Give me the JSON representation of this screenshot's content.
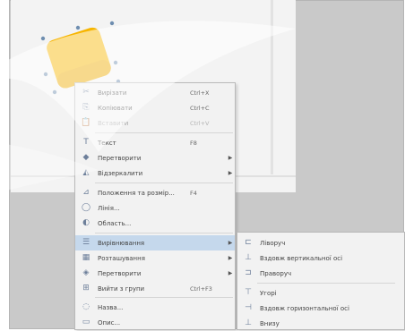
{
  "context_menu": {
    "items": [
      {
        "label": "Вирізати",
        "shortcut": "Ctrl+X",
        "icon": "scissors-icon",
        "glyph": "✂",
        "disabled": false,
        "submenu": false
      },
      {
        "label": "Копіювати",
        "shortcut": "Ctrl+C",
        "icon": "copy-icon",
        "glyph": "⎘",
        "disabled": false,
        "submenu": false
      },
      {
        "label": "Вставити",
        "shortcut": "Ctrl+V",
        "icon": "paste-icon",
        "glyph": "📋",
        "disabled": true,
        "submenu": false
      },
      {
        "label": "Текст",
        "shortcut": "F8",
        "icon": "text-icon",
        "glyph": "T",
        "disabled": false,
        "submenu": false
      },
      {
        "label": "Перетворити",
        "shortcut": "",
        "icon": "convert-icon",
        "glyph": "◆",
        "disabled": false,
        "submenu": true
      },
      {
        "label": "Відзеркалити",
        "shortcut": "",
        "icon": "mirror-icon",
        "glyph": "◭",
        "disabled": false,
        "submenu": true
      },
      {
        "label": "Положення та розмір...",
        "shortcut": "F4",
        "icon": "position-size-icon",
        "glyph": "⊿",
        "disabled": false,
        "submenu": false
      },
      {
        "label": "Лінія...",
        "shortcut": "",
        "icon": "line-icon",
        "glyph": "◯",
        "disabled": false,
        "submenu": false
      },
      {
        "label": "Область...",
        "shortcut": "",
        "icon": "area-icon",
        "glyph": "◐",
        "disabled": false,
        "submenu": false
      },
      {
        "label": "Вирівнювання",
        "shortcut": "",
        "icon": "align-icon",
        "glyph": "☰",
        "disabled": false,
        "submenu": true,
        "highlighted": true
      },
      {
        "label": "Розташування",
        "shortcut": "",
        "icon": "arrange-icon",
        "glyph": "▦",
        "disabled": false,
        "submenu": true
      },
      {
        "label": "Перетворити",
        "shortcut": "",
        "icon": "flip-icon",
        "glyph": "◈",
        "disabled": false,
        "submenu": true
      },
      {
        "label": "Вийти з групи",
        "shortcut": "Ctrl+F3",
        "icon": "exit-group-icon",
        "glyph": "⊞",
        "disabled": false,
        "submenu": false
      },
      {
        "label": "Назва...",
        "shortcut": "",
        "icon": "name-icon",
        "glyph": "◌",
        "disabled": false,
        "submenu": false
      },
      {
        "label": "Опис...",
        "shortcut": "",
        "icon": "description-icon",
        "glyph": "▭",
        "disabled": false,
        "submenu": false
      }
    ]
  },
  "align_submenu": {
    "items": [
      {
        "label": "Ліворуч",
        "icon": "align-left-icon",
        "glyph": "⊏"
      },
      {
        "label": "Вздовж вертикальної осі",
        "icon": "align-center-vertical-icon",
        "glyph": "⊥"
      },
      {
        "label": "Праворуч",
        "icon": "align-right-icon",
        "glyph": "⊐"
      },
      {
        "label": "Угорі",
        "icon": "align-top-icon",
        "glyph": "⊤"
      },
      {
        "label": "Вздовж горизонтальної осі",
        "icon": "align-center-horizontal-icon",
        "glyph": "⊣"
      },
      {
        "label": "Внизу",
        "icon": "align-bottom-icon",
        "glyph": "⊥"
      }
    ]
  },
  "colors": {
    "shape_fill": "#f7b500",
    "shape_shadow": "#c98f00",
    "highlight": "#c5d8ec",
    "menu_background": "#f2f2f2",
    "workspace": "#c9c9c9"
  }
}
